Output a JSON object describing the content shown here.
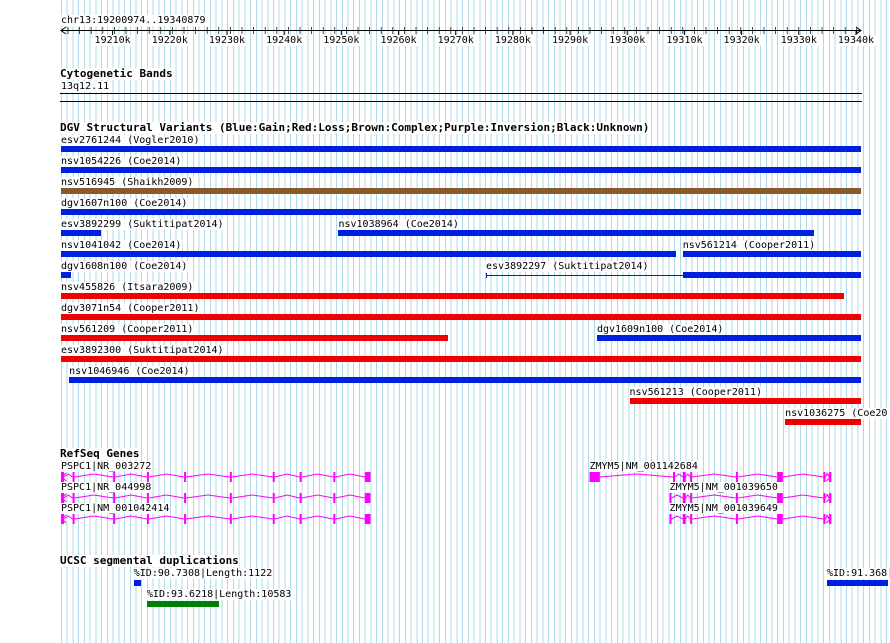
{
  "ruler": {
    "position_label": "chr13:19200974..19340879",
    "ticks": [
      "19210k",
      "19220k",
      "19230k",
      "19240k",
      "19250k",
      "19260k",
      "19270k",
      "19280k",
      "19290k",
      "19300k",
      "19310k",
      "19320k",
      "19330k",
      "19340k"
    ]
  },
  "cytobands": {
    "title": "Cytogenetic Bands",
    "band": "13q12.11"
  },
  "dgv": {
    "title": "DGV Structural Variants (Blue:Gain;Red:Loss;Brown:Complex;Purple:Inversion;Black:Unknown)",
    "colors": {
      "gain": "#0020e0",
      "loss": "#f00000",
      "complex": "#8b5a2b"
    },
    "features": [
      {
        "label": "esv2761244 (Vogler2010)",
        "type": "gain",
        "start": 19200974,
        "end": 19340879,
        "row": 0
      },
      {
        "label": "nsv1054226 (Coe2014)",
        "type": "gain",
        "start": 19200974,
        "end": 19340879,
        "row": 1
      },
      {
        "label": "nsv516945 (Shaikh2009)",
        "type": "complex",
        "start": 19200974,
        "end": 19340879,
        "row": 2
      },
      {
        "label": "dgv1607n100 (Coe2014)",
        "type": "gain",
        "start": 19200974,
        "end": 19340879,
        "row": 3
      },
      {
        "label": "esv3892299 (Suktitipat2014)",
        "type": "gain",
        "start": 19200974,
        "end": 19208000,
        "row": 4
      },
      {
        "label": "nsv1038964 (Coe2014)",
        "type": "gain",
        "start": 19249500,
        "end": 19332700,
        "row": 4
      },
      {
        "label": "nsv1041042 (Coe2014)",
        "type": "gain",
        "start": 19200974,
        "end": 19308600,
        "row": 5
      },
      {
        "label": "nsv561214 (Cooper2011)",
        "type": "gain",
        "start": 19309700,
        "end": 19340879,
        "row": 5
      },
      {
        "label": "dgv1608n100 (Coe2014)",
        "type": "gain",
        "start": 19200974,
        "end": 19202700,
        "row": 6
      },
      {
        "label": "esv3892297 (Suktitipat2014)",
        "type": "gain",
        "start": 19275300,
        "end": 19309700,
        "row": 6,
        "thin": true
      },
      {
        "label": "",
        "type": "gain",
        "start": 19309700,
        "end": 19340879,
        "row": 6
      },
      {
        "label": "nsv455826 (Itsara2009)",
        "type": "loss",
        "start": 19200974,
        "end": 19337900,
        "row": 7
      },
      {
        "label": "dgv3071n54 (Cooper2011)",
        "type": "loss",
        "start": 19200974,
        "end": 19340879,
        "row": 8
      },
      {
        "label": "nsv561209 (Cooper2011)",
        "type": "loss",
        "start": 19200974,
        "end": 19268700,
        "row": 9
      },
      {
        "label": "dgv1609n100 (Coe2014)",
        "type": "gain",
        "start": 19294700,
        "end": 19340879,
        "row": 9
      },
      {
        "label": "esv3892300 (Suktitipat2014)",
        "type": "loss",
        "start": 19200974,
        "end": 19340879,
        "row": 10
      },
      {
        "label": "nsv1046946 (Coe2014)",
        "type": "gain",
        "start": 19202400,
        "end": 19340879,
        "row": 11
      },
      {
        "label": "nsv561213 (Cooper2011)",
        "type": "loss",
        "start": 19300400,
        "end": 19340879,
        "row": 12
      },
      {
        "label": "nsv1036275 (Coe20",
        "type": "loss",
        "start": 19327600,
        "end": 19340879,
        "row": 13
      }
    ]
  },
  "refseq": {
    "title": "RefSeq Genes",
    "color": "#ff00ff",
    "genes": [
      {
        "label": "PSPC1|NR_003272",
        "strand": "-",
        "start": 19200974,
        "end": 19255100,
        "row": 0,
        "exons": [
          [
            19200974,
            19201500
          ],
          [
            19203000,
            19203200
          ],
          [
            19210100,
            19210300
          ],
          [
            19216000,
            19216200
          ],
          [
            19222500,
            19222700
          ],
          [
            19230500,
            19230700
          ],
          [
            19238000,
            19238200
          ],
          [
            19242700,
            19242900
          ],
          [
            19248600,
            19248800
          ],
          [
            19254100,
            19255100
          ]
        ]
      },
      {
        "label": "PSPC1|NR_044998",
        "strand": "-",
        "start": 19200974,
        "end": 19255100,
        "row": 1,
        "exons": [
          [
            19200974,
            19201500
          ],
          [
            19203000,
            19203200
          ],
          [
            19210100,
            19210300
          ],
          [
            19216000,
            19216200
          ],
          [
            19222500,
            19222700
          ],
          [
            19230500,
            19230700
          ],
          [
            19238000,
            19238200
          ],
          [
            19242700,
            19242900
          ],
          [
            19248600,
            19248800
          ],
          [
            19254100,
            19255100
          ]
        ]
      },
      {
        "label": "PSPC1|NM_001042414",
        "strand": "-",
        "start": 19200974,
        "end": 19255100,
        "row": 2,
        "exons": [
          [
            19200974,
            19201500
          ],
          [
            19203000,
            19203200
          ],
          [
            19210100,
            19210300
          ],
          [
            19216000,
            19216200
          ],
          [
            19222500,
            19222700
          ],
          [
            19230500,
            19230700
          ],
          [
            19238000,
            19238200
          ],
          [
            19242700,
            19242900
          ],
          [
            19248600,
            19248800
          ],
          [
            19254100,
            19255100
          ]
        ]
      },
      {
        "label": "ZMYM5|NM_001142684",
        "strand": "+",
        "start": 19293400,
        "end": 19335700,
        "row": 0,
        "exons": [
          [
            19293400,
            19295200
          ],
          [
            19308000,
            19308200
          ],
          [
            19309700,
            19310200
          ],
          [
            19311000,
            19311300
          ],
          [
            19319000,
            19319200
          ],
          [
            19326200,
            19327200
          ],
          [
            19334300,
            19334500
          ],
          [
            19335300,
            19335700
          ]
        ]
      },
      {
        "label": "ZMYM5|NM_001039650",
        "strand": "+",
        "start": 19307400,
        "end": 19335700,
        "row": 1,
        "exons": [
          [
            19307400,
            19307700
          ],
          [
            19309700,
            19310200
          ],
          [
            19311000,
            19311300
          ],
          [
            19319000,
            19319200
          ],
          [
            19326200,
            19327200
          ],
          [
            19334300,
            19334500
          ],
          [
            19335300,
            19335700
          ]
        ]
      },
      {
        "label": "ZMYM5|NM_001039649",
        "strand": "+",
        "start": 19307400,
        "end": 19335700,
        "row": 2,
        "exons": [
          [
            19307400,
            19307700
          ],
          [
            19309700,
            19310200
          ],
          [
            19311000,
            19311300
          ],
          [
            19319000,
            19319200
          ],
          [
            19326200,
            19327200
          ],
          [
            19334300,
            19334500
          ],
          [
            19335300,
            19335700
          ]
        ]
      }
    ]
  },
  "segdups": {
    "title": "UCSC segmental duplications",
    "features": [
      {
        "label": "%ID:90.7308|Length:1122",
        "start": 19213700,
        "end": 19214900,
        "color": "#0020e0",
        "row": 0
      },
      {
        "label": "%ID:91.368|",
        "start": 19347700,
        "end": 19349800,
        "color": "#0020e0",
        "row": 0
      },
      {
        "label": "%ID:93.6218|Length:10583",
        "start": 19216000,
        "end": 19228600,
        "color": "#008000",
        "row": 1
      }
    ]
  }
}
